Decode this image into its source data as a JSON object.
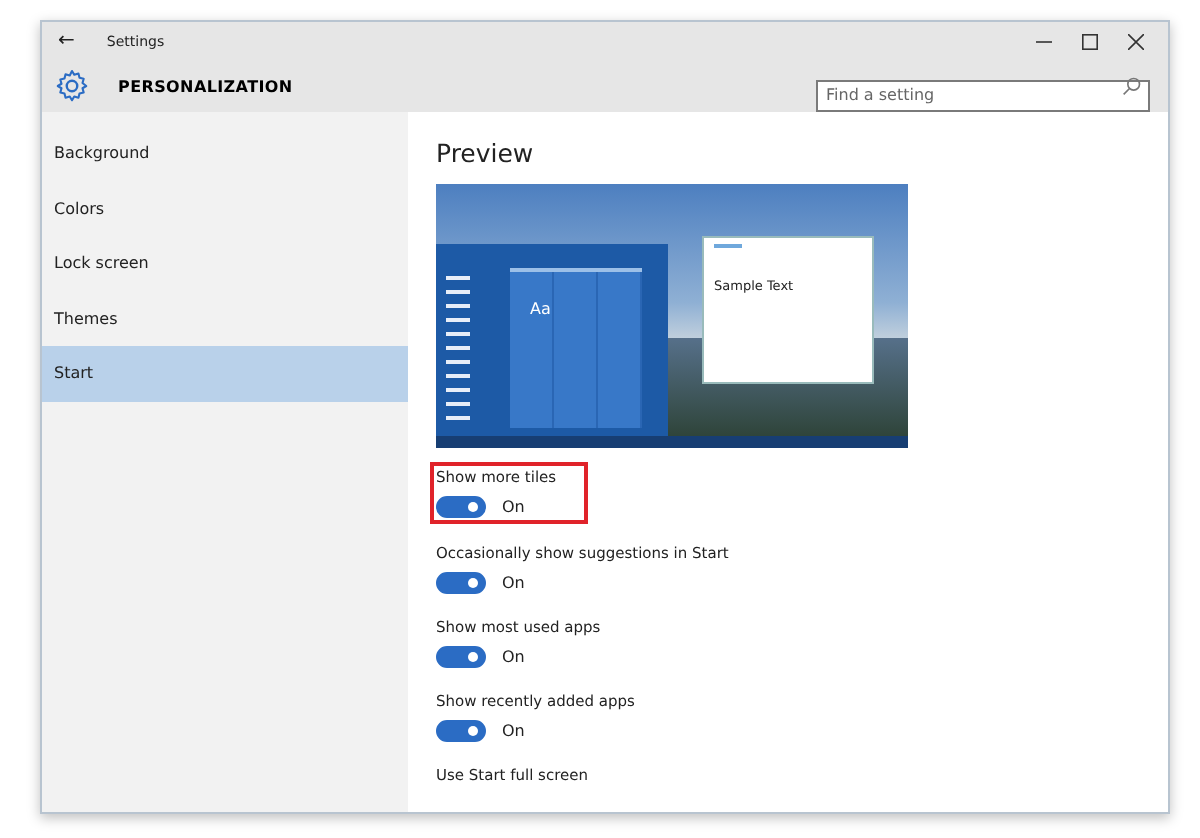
{
  "window": {
    "title": "Settings",
    "back": "←"
  },
  "header": {
    "title": "PERSONALIZATION",
    "search": {
      "placeholder": "Find a setting"
    }
  },
  "sidebar": {
    "items": [
      {
        "label": "Background",
        "selected": false
      },
      {
        "label": "Colors",
        "selected": false
      },
      {
        "label": "Lock screen",
        "selected": false
      },
      {
        "label": "Themes",
        "selected": false
      },
      {
        "label": "Start",
        "selected": true
      }
    ]
  },
  "content": {
    "heading": "Preview",
    "preview": {
      "tile_text": "Aa",
      "sample_text": "Sample Text"
    },
    "settings": [
      {
        "label": "Show more tiles",
        "on": true,
        "state": "On",
        "highlighted": true
      },
      {
        "label": "Occasionally show suggestions in Start",
        "on": true,
        "state": "On",
        "highlighted": false
      },
      {
        "label": "Show most used apps",
        "on": true,
        "state": "On",
        "highlighted": false
      },
      {
        "label": "Show recently added apps",
        "on": true,
        "state": "On",
        "highlighted": false
      },
      {
        "label": "Use Start full screen",
        "kind": "cut"
      }
    ]
  }
}
